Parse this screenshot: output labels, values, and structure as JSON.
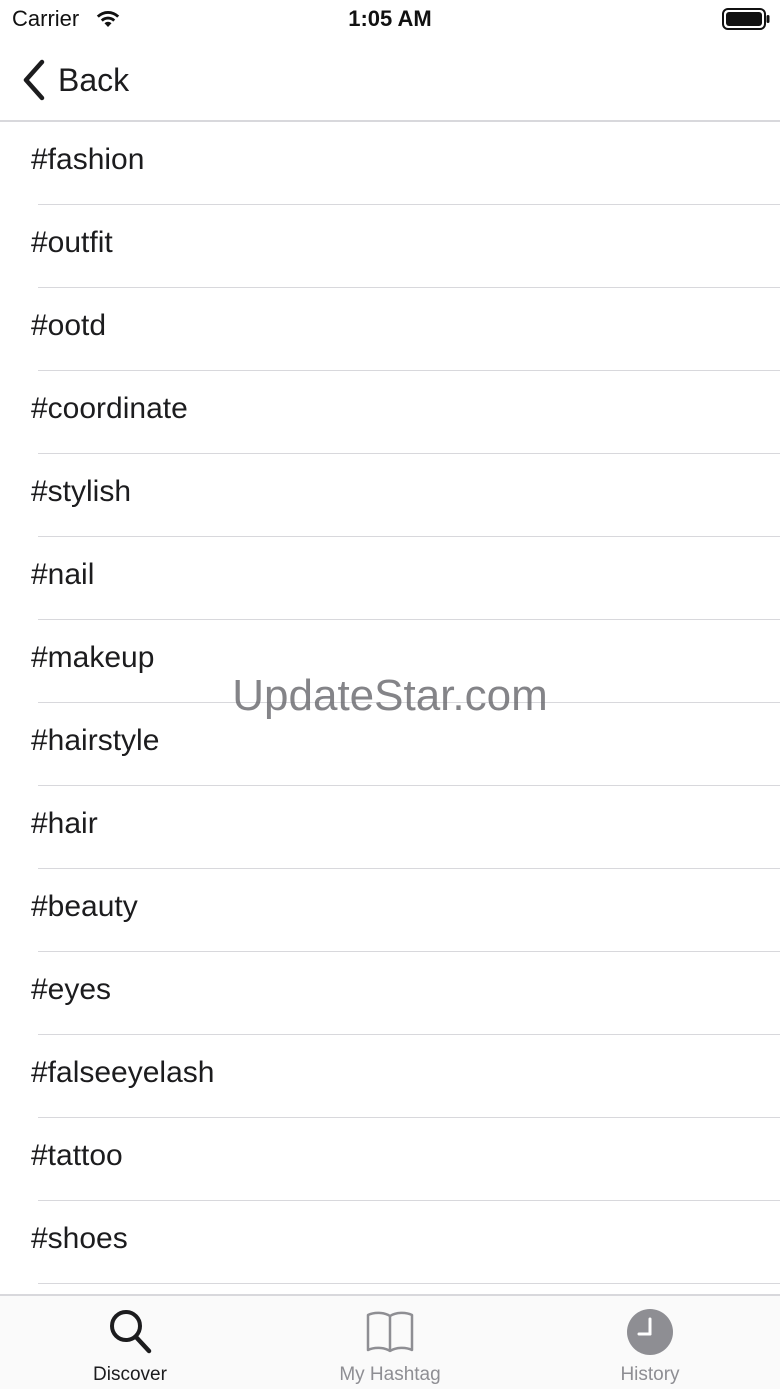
{
  "status_bar": {
    "carrier": "Carrier",
    "time": "1:05 AM"
  },
  "nav": {
    "back_label": "Back"
  },
  "hashtags": [
    "#fashion",
    "#outfit",
    "#ootd",
    "#coordinate",
    "#stylish",
    "#nail",
    "#makeup",
    "#hairstyle",
    "#hair",
    "#beauty",
    "#eyes",
    "#falseeyelash",
    "#tattoo",
    "#shoes"
  ],
  "watermark": "UpdateStar.com",
  "tab_bar": {
    "tabs": [
      {
        "label": "Discover",
        "icon": "search-icon",
        "active": true
      },
      {
        "label": "My Hashtag",
        "icon": "book-icon",
        "active": false
      },
      {
        "label": "History",
        "icon": "clock-icon",
        "active": false
      }
    ]
  },
  "colors": {
    "active_tab": "#1c1c1e",
    "inactive_tab": "#8e8e93",
    "separator": "#d8d8dc"
  }
}
